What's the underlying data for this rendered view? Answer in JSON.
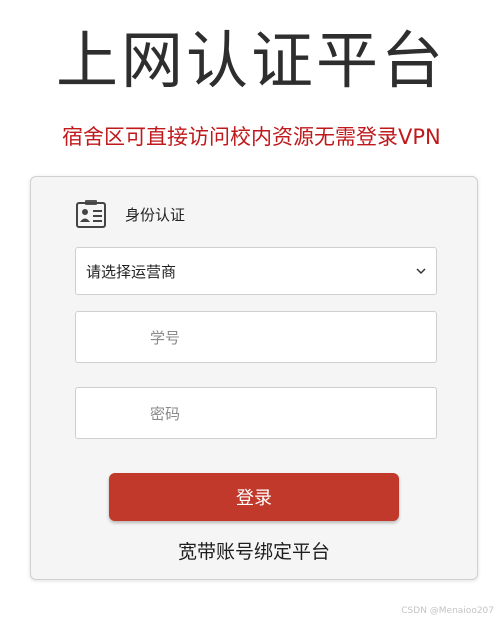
{
  "page": {
    "title": "上网认证平台",
    "notice": "宿舍区可直接访问校内资源无需登录VPN"
  },
  "login_form": {
    "header_label": "身份认证",
    "header_icon": "id-card-icon",
    "isp_select": {
      "selected": "请选择运营商",
      "icon": "chevron-down-icon"
    },
    "student_id": {
      "value": "",
      "placeholder": "学号"
    },
    "password": {
      "value": "",
      "placeholder": "密码"
    },
    "login_button_label": "登录",
    "bind_link_label": "宽带账号绑定平台"
  },
  "watermark": "CSDN @Menaioo207",
  "colors": {
    "notice": "#c0191c",
    "button": "#c0392b",
    "card_background": "#f5f5f5"
  }
}
